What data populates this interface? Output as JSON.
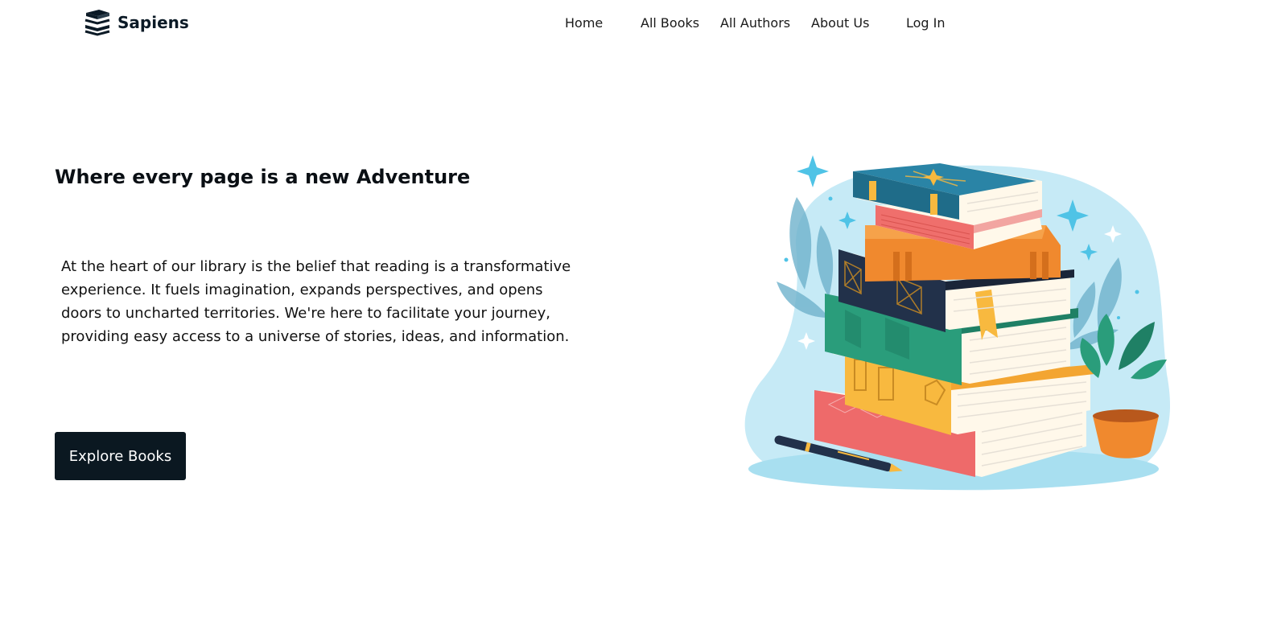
{
  "brand": {
    "name": "Sapiens",
    "logo_icon": "book-stack-icon"
  },
  "nav": {
    "items": [
      {
        "id": "home",
        "label": "Home"
      },
      {
        "id": "all-books",
        "label": "All Books"
      },
      {
        "id": "all-authors",
        "label": "All Authors"
      },
      {
        "id": "about-us",
        "label": "About Us"
      },
      {
        "id": "log-in",
        "label": "Log In"
      }
    ]
  },
  "hero": {
    "headline": "Where every page is a new Adventure",
    "body": "At the heart of our library is the belief that reading is a transformative experience. It fuels imagination, expands perspectives, and opens doors to uncharted territories. We're here to facilitate your journey, providing easy access to a universe of stories, ideas, and information.",
    "cta_label": "Explore Books",
    "illustration": "stack-of-books-illustration"
  },
  "colors": {
    "primary_dark": "#0b1821",
    "blob": "#c6eaf6",
    "book_teal": "#2a84a6",
    "book_coral": "#ef6f6c",
    "book_orange": "#f0892e",
    "book_navy": "#22314a",
    "book_green": "#2a9d7b",
    "book_yellow": "#f8b93f",
    "book_red": "#ee6a6a"
  }
}
